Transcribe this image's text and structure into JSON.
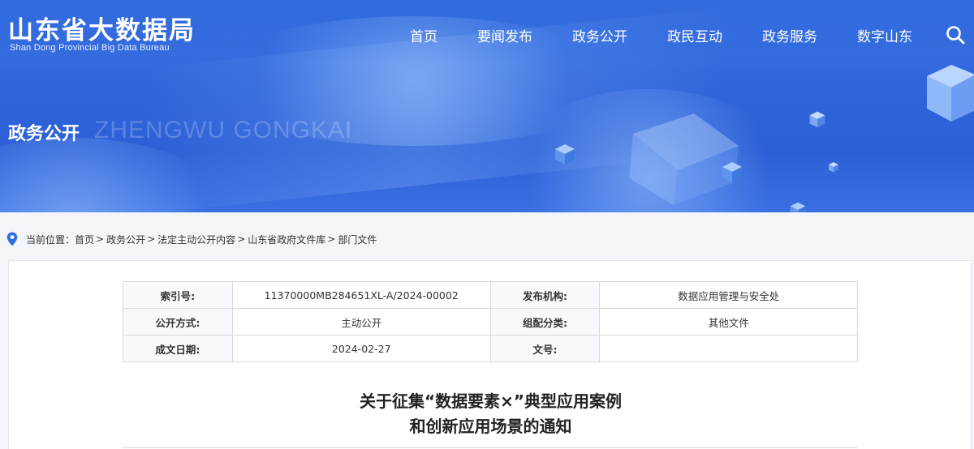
{
  "site": {
    "title": "山东省大数据局",
    "subtitle": "Shan Dong Provincial Big Data Bureau"
  },
  "nav": {
    "items": [
      "首页",
      "要闻发布",
      "政务公开",
      "政民互动",
      "政务服务",
      "数字山东"
    ]
  },
  "banner": {
    "heading": "政务公开",
    "heading_en": "ZHENGWU GONGKAI"
  },
  "breadcrumb": {
    "prefix": "当前位置：",
    "items": [
      "首页",
      "政务公开",
      "法定主动公开内容",
      "山东省政府文件库",
      "部门文件"
    ]
  },
  "meta": {
    "index_label": "索引号:",
    "index_value": "11370000MB284651XL-A/2024-00002",
    "publisher_label": "发布机构:",
    "publisher_value": "数据应用管理与安全处",
    "disclosure_label": "公开方式:",
    "disclosure_value": "主动公开",
    "category_label": "组配分类:",
    "category_value": "其他文件",
    "date_label": "成文日期:",
    "date_value": "2024-02-27",
    "docno_label": "文号:",
    "docno_value": ""
  },
  "document": {
    "title_line1": "关于征集“数据要素×”典型应用案例",
    "title_line2": "和创新应用场景的通知"
  },
  "colors": {
    "banner": "#3268dc",
    "pin": "#2f6fe0"
  }
}
